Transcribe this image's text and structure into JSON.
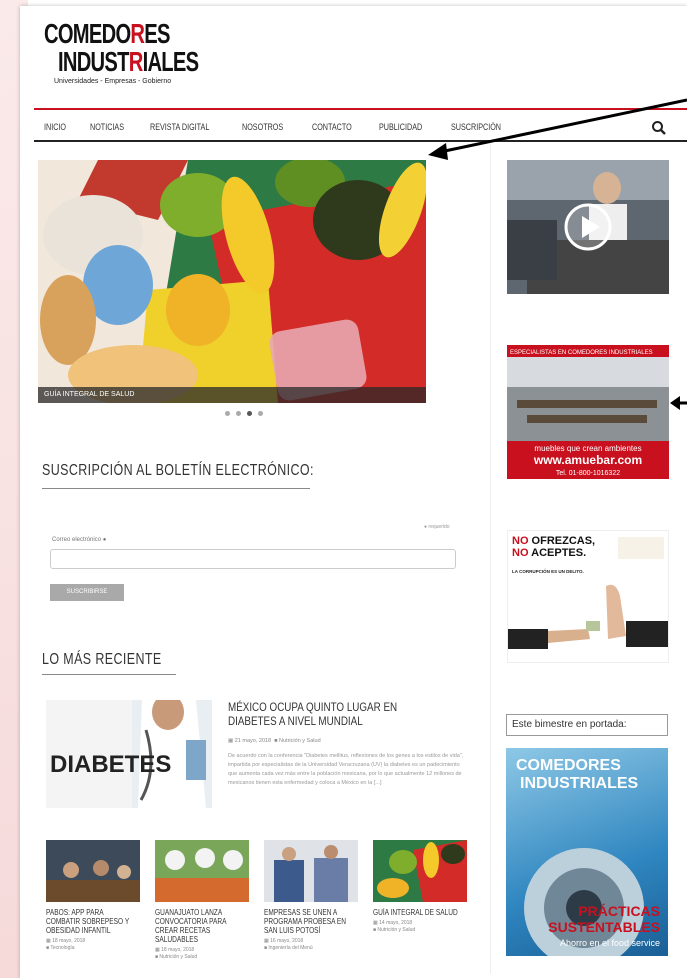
{
  "logo": {
    "line1a": "COMEDO",
    "line1r": "R",
    "line1b": "ES",
    "line2a": "INDUST",
    "line2r": "R",
    "line2b": "IALES",
    "tagline": "Universidades - Empresas - Gobierno"
  },
  "nav": {
    "items": [
      "INICIO",
      "NOTICIAS",
      "REVISTA DIGITAL",
      "NOSOTROS",
      "CONTACTO",
      "PUBLICIDAD",
      "SUSCRIPCIÓN"
    ]
  },
  "slider": {
    "caption": "GUÍA INTEGRAL DE SALUD",
    "dots": 4,
    "active_dot": 3
  },
  "newsletter": {
    "title": "SUSCRIPCIÓN AL BOLETÍN ELECTRÓNICO:",
    "required": "● requerido",
    "email_label": "Correo electrónico ●",
    "button": "SUSCRIBIRSE"
  },
  "recent": {
    "title": "LO MÁS RECIENTE",
    "featured": {
      "img_text": "DIABETES",
      "title": "MÉXICO OCUPA QUINTO LUGAR EN DIABETES A NIVEL MUNDIAL",
      "date": "21 mayo, 2018",
      "category": "Nutrición y Salud",
      "excerpt": "De acuerdo con la conferencia \"Diabetes mellitus, reflexiones de los genes a los estilos de vida\", impartida por especialistas de la Universidad Veracruzana (UV) la diabetes es un padecimiento que aumenta cada vez más entre la población mexicana, por lo que actualmente 12 millones de mexicanos tienen esta enfermedad y coloca a México en la [...]"
    },
    "cards": [
      {
        "title": "PABOS: APP PARA COMBATIR SOBREPESO Y OBESIDAD INFANTIL",
        "date": "18 mayo, 2018",
        "category": "Tecnología"
      },
      {
        "title": "GUANAJUATO LANZA CONVOCATORIA PARA CREAR RECETAS SALUDABLES",
        "date": "18 mayo, 2018",
        "category": "Nutrición y Salud"
      },
      {
        "title": "EMPRESAS SE UNEN A PROGRAMA PROBESA EN SAN LUIS POTOSÍ",
        "date": "16 mayo, 2018",
        "category": "Ingeniería del Menú"
      },
      {
        "title": "GUÍA INTEGRAL DE SALUD",
        "date": "14 mayo, 2018",
        "category": "Nutrición y Salud"
      }
    ]
  },
  "ads": {
    "ad1": {
      "top": "ESPECIALISTAS EN COMEDORES INDUSTRIALES",
      "line1": "muebles que crean ambientes",
      "url": "www.amuebar.com",
      "tel": "Tel. 01-800-1016322"
    },
    "ad2": {
      "line1a": "NO",
      "line1b": " OFREZCAS,",
      "line2a": "NO",
      "line2b": " ACEPTES.",
      "sub": "LA CORRUPCIÓN ES UN DELITO."
    }
  },
  "magazine": {
    "label": "Este bimestre en portada:",
    "cover_logo1": "COMEDORES",
    "cover_logo2": "INDUSTRIALES",
    "headline1": "PRÁCTICAS",
    "headline2": "SUSTENTABLES",
    "sub": "Ahorro en el food service"
  },
  "colors": {
    "brand": "#c8101e",
    "nav_border": "#222"
  }
}
